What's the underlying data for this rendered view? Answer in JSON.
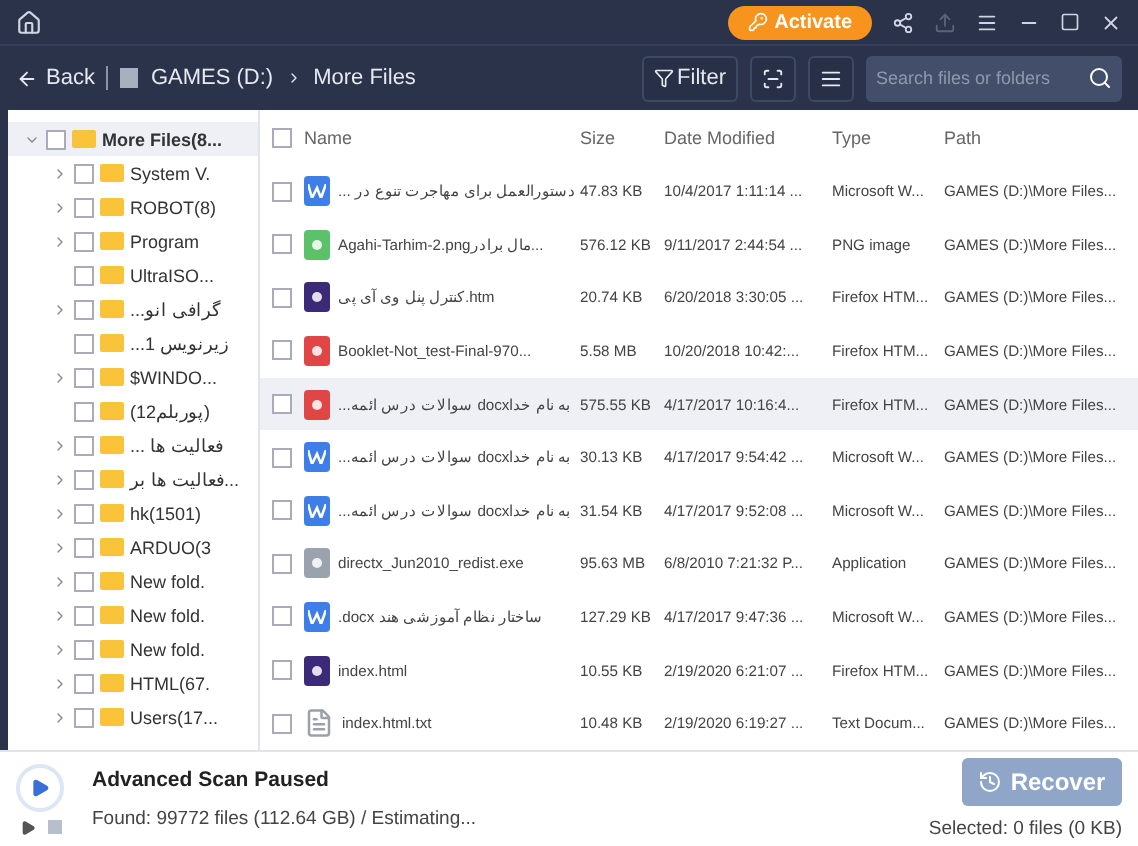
{
  "title_bar": {
    "activate": "Activate"
  },
  "toolbar": {
    "back": "Back",
    "breadcrumb": [
      "GAMES (D:)",
      "More Files"
    ],
    "filter": "Filter",
    "search": {
      "placeholder": "Search files or folders"
    }
  },
  "tree": [
    {
      "label": "More Files(8...",
      "expanded": true,
      "checked": false,
      "children": [
        {
          "label": "System V.",
          "expandable": true,
          "checked": false
        },
        {
          "label": "ROBOT(8)",
          "expandable": true,
          "checked": false
        },
        {
          "label": "Program",
          "expandable": true,
          "checked": false
        },
        {
          "label": "UltraISO...",
          "expandable": false,
          "checked": false
        },
        {
          "label": "...گرافی انو",
          "expandable": true,
          "checked": false
        },
        {
          "label": "...زیرنویس 1",
          "expandable": false,
          "checked": false
        },
        {
          "label": "$WINDO...",
          "expandable": true,
          "checked": false
        },
        {
          "label": "(پوربلم12)",
          "expandable": false,
          "checked": false
        },
        {
          "label": "... فعالیت ها",
          "expandable": true,
          "checked": false
        },
        {
          "label": "فعالیت ها بر...",
          "expandable": true,
          "checked": false
        },
        {
          "label": "hk(1501)",
          "expandable": true,
          "checked": false
        },
        {
          "label": "ARDUO(3",
          "expandable": true,
          "checked": false
        },
        {
          "label": "New fold.",
          "expandable": true,
          "checked": false
        },
        {
          "label": "New fold.",
          "expandable": true,
          "checked": false
        },
        {
          "label": "New fold.",
          "expandable": true,
          "checked": false
        },
        {
          "label": "HTML(67.",
          "expandable": true,
          "checked": false
        },
        {
          "label": "Users(17...",
          "expandable": true,
          "checked": false
        }
      ]
    }
  ],
  "table": {
    "columns": [
      "Name",
      "Size",
      "Date Modified",
      "Type",
      "Path"
    ],
    "select_all_checked": false,
    "rows": [
      {
        "kind": "word",
        "name": "... دستورالعمل برای مهاجرت تنوع در",
        "size": "47.83 KB",
        "date": "10/4/2017 1:11:14 ...",
        "type": "Microsoft W...",
        "path": "GAMES (D:)\\More Files...",
        "selected": false,
        "checked": false
      },
      {
        "kind": "image",
        "name": "Agahi-Tarhim-2.pngمال برادر...",
        "size": "576.12 KB",
        "date": "9/11/2017 2:44:54 ...",
        "type": "PNG image",
        "path": "GAMES (D:)\\More Files...",
        "selected": false,
        "checked": false
      },
      {
        "kind": "firefox",
        "name": "کنترل پنل وی آی پی.htm",
        "size": "20.74 KB",
        "date": "6/20/2018 3:30:05 ...",
        "type": "Firefox HTM...",
        "path": "GAMES (D:)\\More Files...",
        "selected": false,
        "checked": false
      },
      {
        "kind": "pdf",
        "name": "Booklet-Not_test-Final-970...",
        "size": "5.58 MB",
        "date": "10/20/2018 10:42:...",
        "type": "Firefox HTM...",
        "path": "GAMES (D:)\\More Files...",
        "selected": false,
        "checked": false
      },
      {
        "kind": "pdf",
        "name": "...سوالات درس ائمه docxبه نام خدا",
        "size": "575.55 KB",
        "date": "4/17/2017 10:16:4...",
        "type": "Firefox HTM...",
        "path": "GAMES (D:)\\More Files...",
        "selected": true,
        "checked": false
      },
      {
        "kind": "word",
        "name": "...سوالات درس ائمه docxبه نام خدا",
        "size": "30.13 KB",
        "date": "4/17/2017 9:54:42 ...",
        "type": "Microsoft W...",
        "path": "GAMES (D:)\\More Files...",
        "selected": false,
        "checked": false
      },
      {
        "kind": "word",
        "name": "...سوالات درس ائمه docxبه نام خدا",
        "size": "31.54 KB",
        "date": "4/17/2017 9:52:08 ...",
        "type": "Microsoft W...",
        "path": "GAMES (D:)\\More Files...",
        "selected": false,
        "checked": false
      },
      {
        "kind": "app",
        "name": "directx_Jun2010_redist.exe",
        "size": "95.63 MB",
        "date": "6/8/2010 7:21:32 P...",
        "type": "Application",
        "path": "GAMES (D:)\\More Files...",
        "selected": false,
        "checked": false
      },
      {
        "kind": "word",
        "name": ".docx ساختار نظام آموزشی هند",
        "size": "127.29 KB",
        "date": "4/17/2017 9:47:36 ...",
        "type": "Microsoft W...",
        "path": "GAMES (D:)\\More Files...",
        "selected": false,
        "checked": false
      },
      {
        "kind": "firefox",
        "name": "index.html",
        "size": "10.55 KB",
        "date": "2/19/2020 6:21:07 ...",
        "type": "Firefox HTM...",
        "path": "GAMES (D:)\\More Files...",
        "selected": false,
        "checked": false
      },
      {
        "kind": "text",
        "name": "index.html.txt",
        "size": "10.48 KB",
        "date": "2/19/2020 6:19:27 ...",
        "type": "Text Docum...",
        "path": "GAMES (D:)\\More Files...",
        "selected": false,
        "checked": false
      }
    ]
  },
  "status": {
    "title": "Advanced Scan Paused",
    "found": "Found: 99772 files (112.64 GB) / Estimating...",
    "recover": "Recover",
    "recover_disabled": true,
    "selected_info": "Selected: 0 files (0 KB)"
  }
}
